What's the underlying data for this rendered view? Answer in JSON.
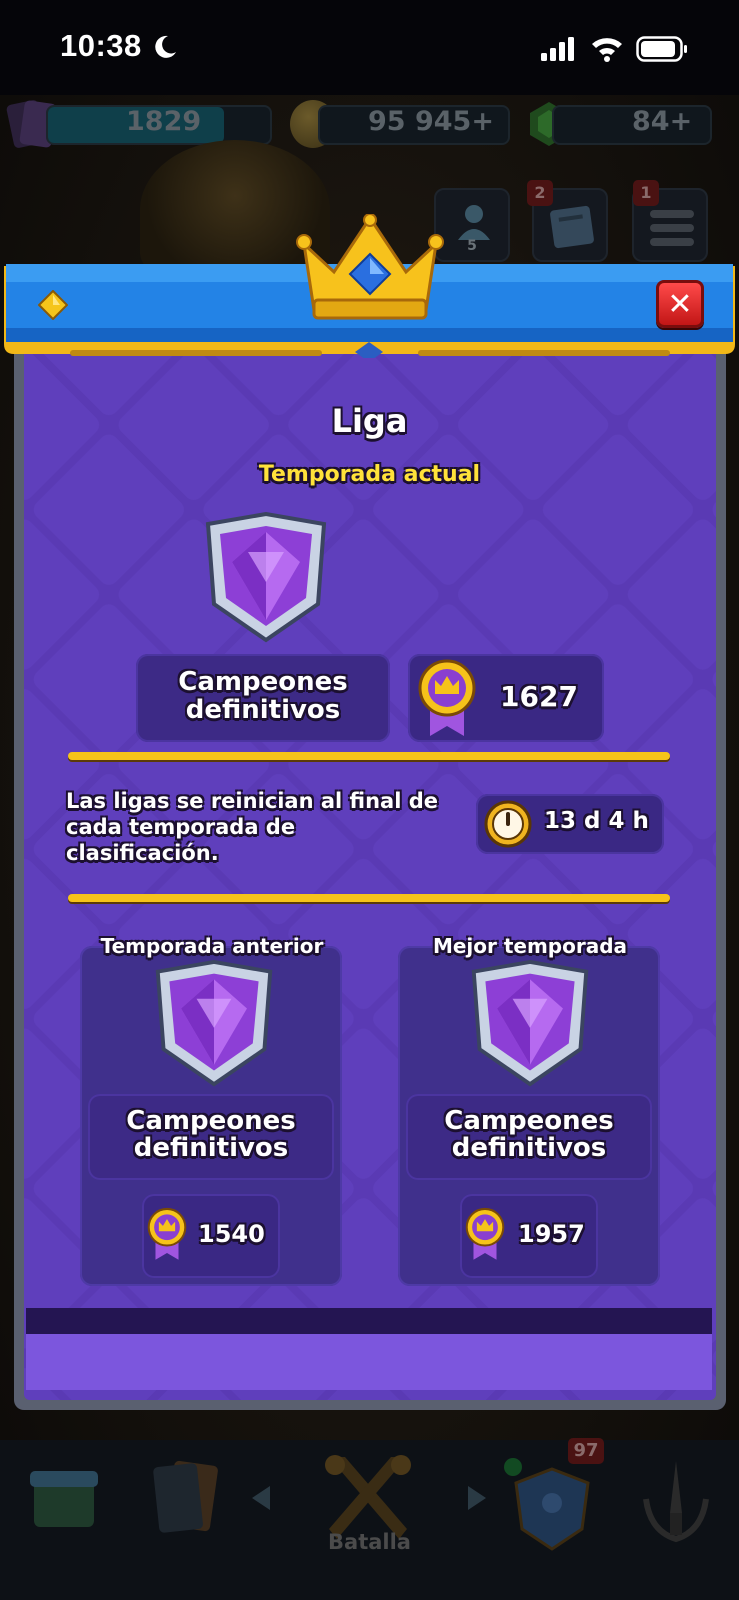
{
  "status_bar": {
    "time": "10:38",
    "icons": [
      "moon-icon",
      "cellular-signal-icon",
      "wifi-icon",
      "battery-icon"
    ]
  },
  "resources": {
    "trophy_road_value": "1829",
    "gold_value": "95 945",
    "gold_plus": "+",
    "gems_value": "84",
    "gems_plus": "+"
  },
  "top_buttons": {
    "friends_count": "5",
    "news_badge": "2",
    "menu_badge": "1"
  },
  "modal": {
    "title": "Liga",
    "subtitle": "Temporada actual",
    "current_league_line1": "Campeones",
    "current_league_line2": "definitivos",
    "current_trophies": "1627",
    "reset_info": "Las ligas se reinician al final de cada temporada de clasificación.",
    "time_remaining": "13 d 4 h",
    "previous_season": {
      "label": "Temporada anterior",
      "league_line1": "Campeones",
      "league_line2": "definitivos",
      "trophies": "1540"
    },
    "best_season": {
      "label": "Mejor temporada",
      "league_line1": "Campeones",
      "league_line2": "definitivos",
      "trophies": "1957"
    },
    "close_glyph": "✕"
  },
  "bottom_nav": {
    "battle_label": "Batalla",
    "clan_badge": "97"
  },
  "colors": {
    "panel_purple": "#5b3bb3",
    "header_blue": "#1f7ee0",
    "gold": "#f6c31a",
    "subtitle_yellow": "#ffe23a",
    "close_red": "#e02222"
  }
}
